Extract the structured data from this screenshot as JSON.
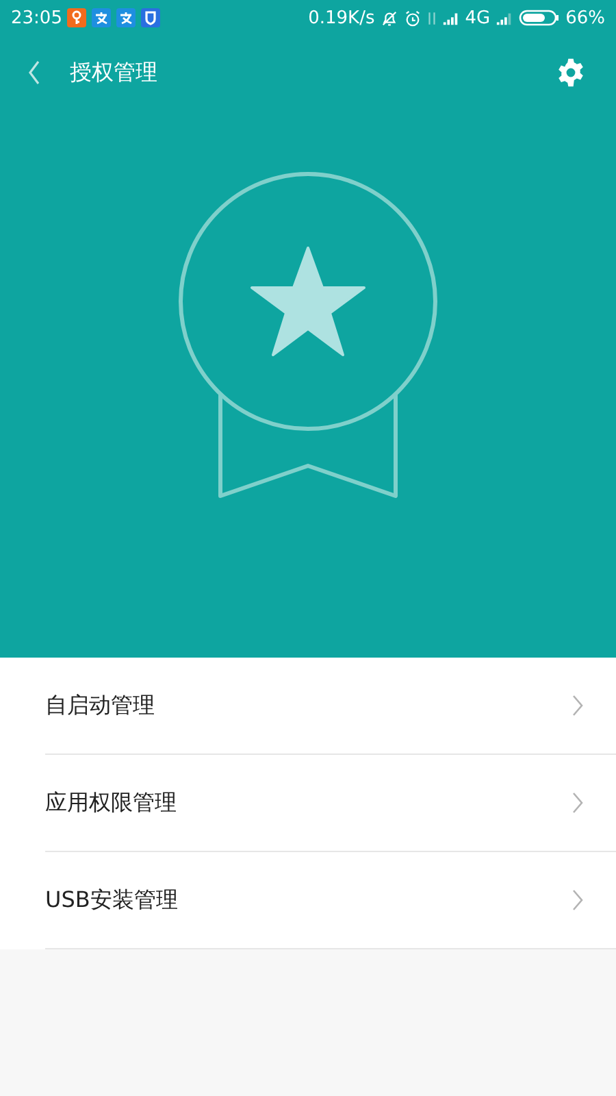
{
  "status_bar": {
    "time": "23:05",
    "speed": "0.19K/s",
    "network": "4G",
    "battery": "66%"
  },
  "header": {
    "title": "授权管理"
  },
  "items": [
    {
      "label": "自启动管理"
    },
    {
      "label": "应用权限管理"
    },
    {
      "label": "USB安装管理"
    }
  ]
}
